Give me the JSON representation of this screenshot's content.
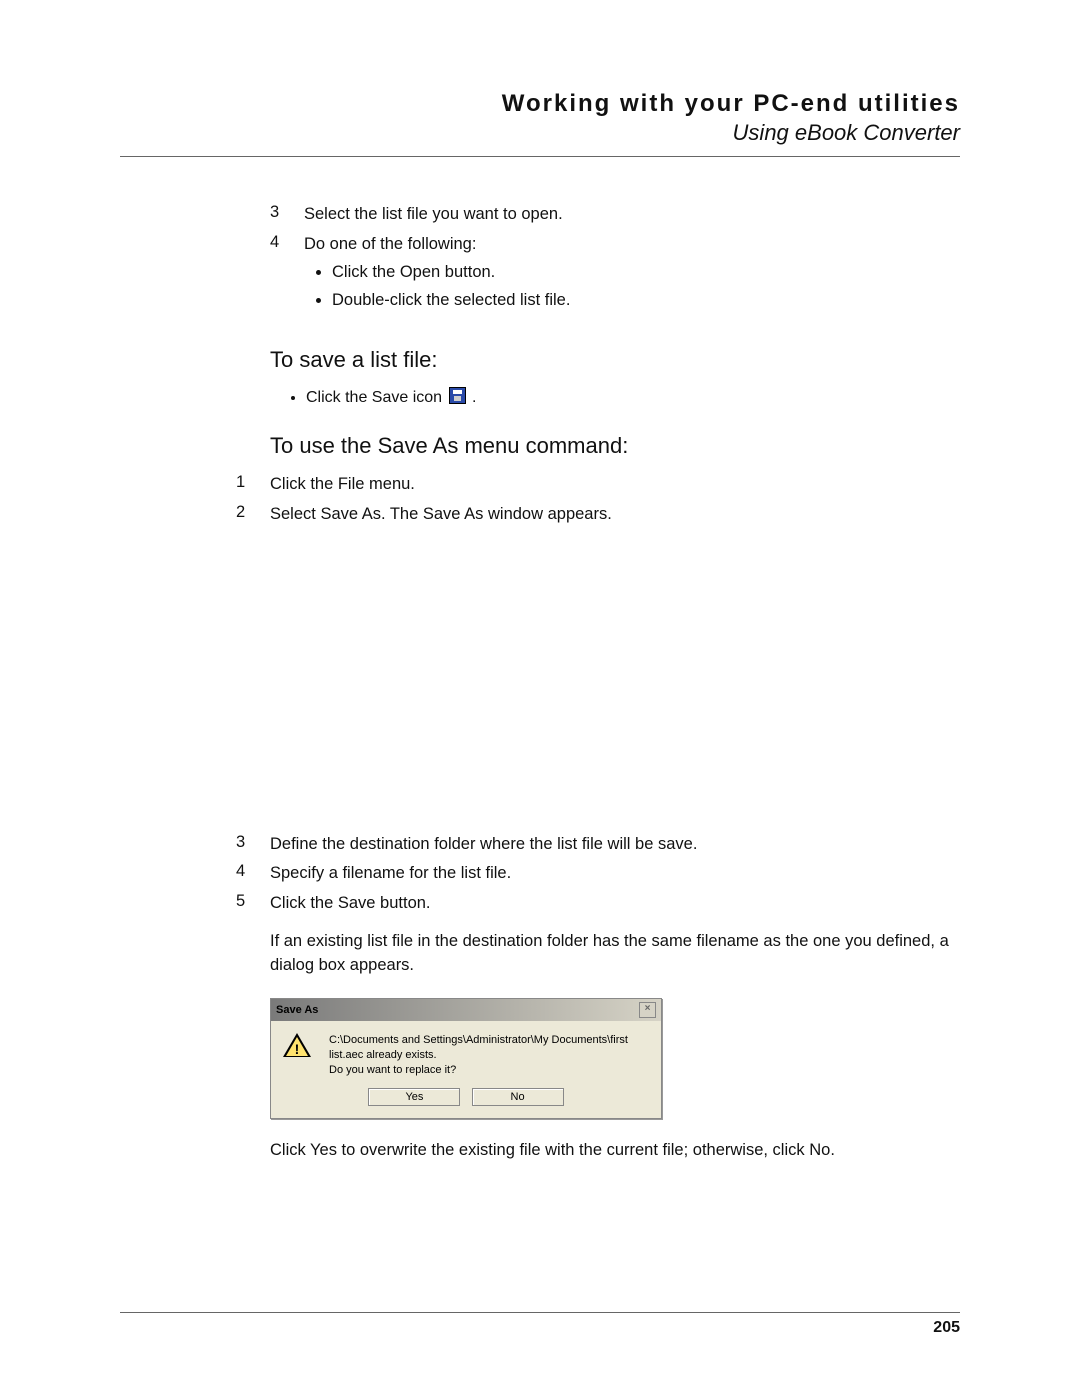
{
  "header": {
    "title": "Working with your PC-end utilities",
    "subtitle": "Using eBook Converter"
  },
  "steps_a": [
    {
      "n": "3",
      "text": "Select the list file you want to open."
    },
    {
      "n": "4",
      "text": "Do one of the following:"
    }
  ],
  "bullets_a": [
    "Click the Open button.",
    "Double-click the selected list file."
  ],
  "section_save_heading": "To save a list file:",
  "save_bullet_pre": "Click the Save icon ",
  "save_bullet_post": " .",
  "section_saveas_heading": "To use the Save As menu command:",
  "steps_b": [
    {
      "n": "1",
      "text": "Click the File menu."
    },
    {
      "n": "2",
      "text": "Select Save As. The Save As window appears."
    }
  ],
  "steps_c": [
    {
      "n": "3",
      "text": "Define the destination folder where the list file will be save."
    },
    {
      "n": "4",
      "text": "Specify a filename for the list file."
    },
    {
      "n": "5",
      "text": "Click the Save button."
    }
  ],
  "after_step5_text": "If an existing list file in the destination folder has the same filename as the one you defined, a dialog box appears.",
  "dialog": {
    "title": "Save As",
    "message_line1": "C:\\Documents and Settings\\Administrator\\My Documents\\first list.aec already exists.",
    "message_line2": "Do you want to replace it?",
    "yes": "Yes",
    "no": "No",
    "close": "×"
  },
  "after_dialog_text": "Click Yes to overwrite the existing file with the current file; otherwise, click No.",
  "page_number": "205"
}
